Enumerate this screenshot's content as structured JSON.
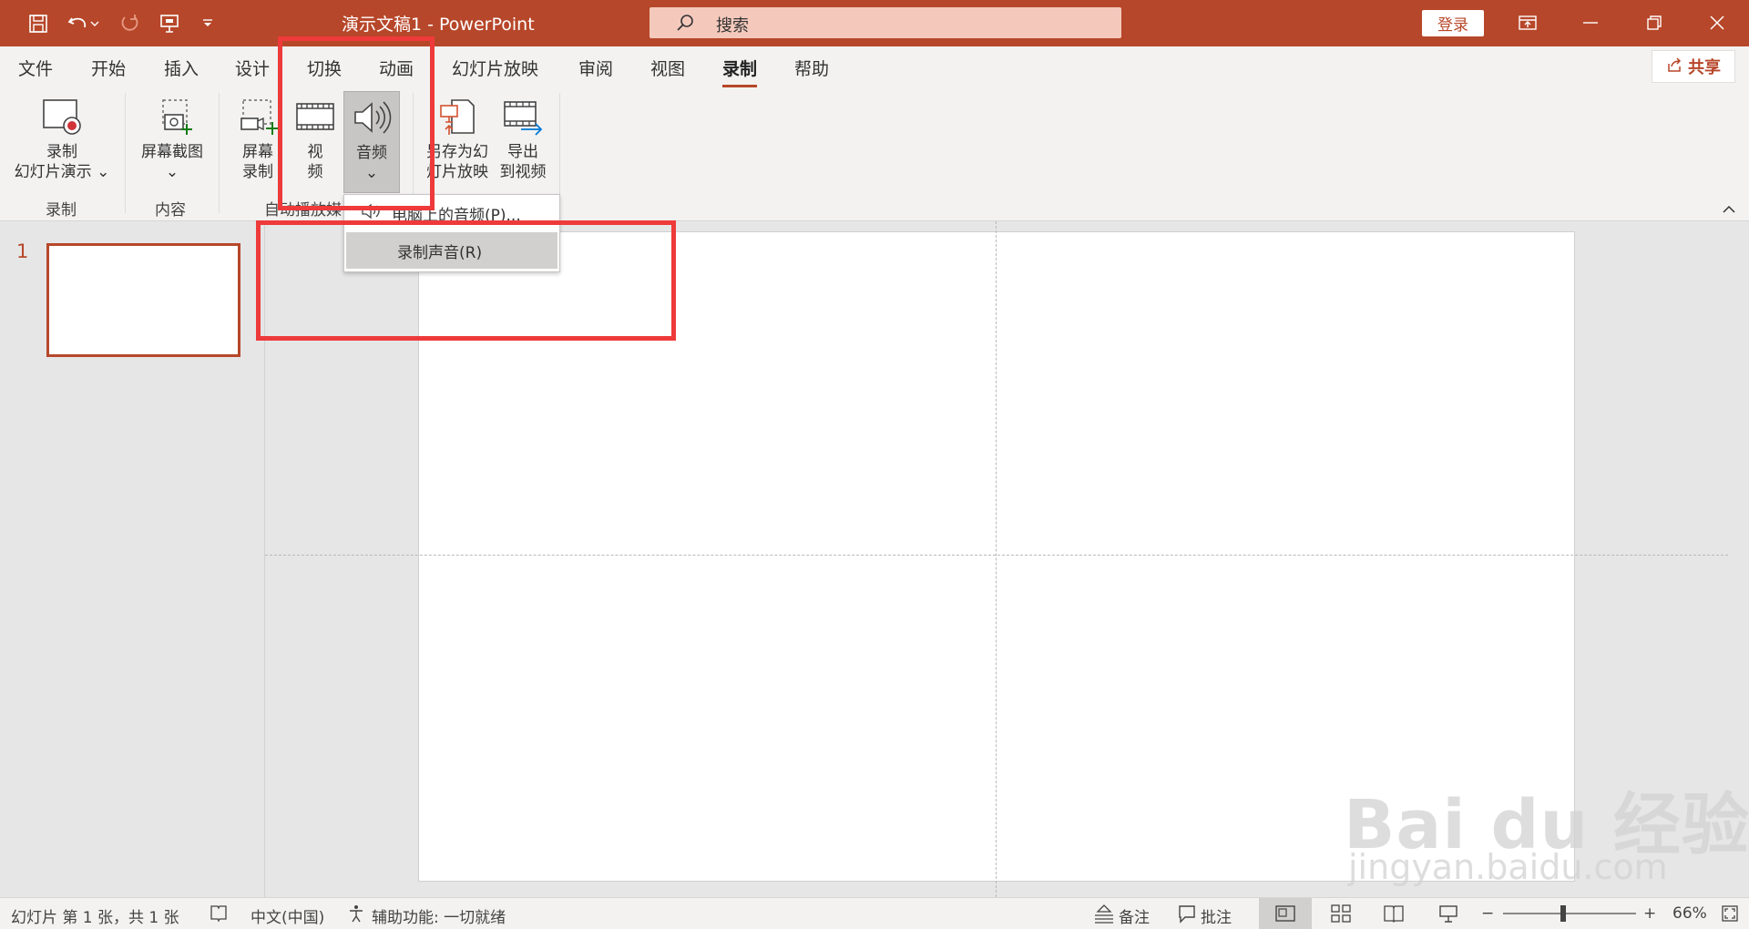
{
  "title_bar": {
    "doc_title": "演示文稿1  -  PowerPoint",
    "search_placeholder": "搜索",
    "login_label": "登录"
  },
  "menu": {
    "tabs": [
      "文件",
      "开始",
      "插入",
      "设计",
      "切换",
      "动画",
      "幻灯片放映",
      "审阅",
      "视图",
      "录制",
      "帮助"
    ],
    "active_tab": "录制",
    "share_label": "共享"
  },
  "ribbon": {
    "record_slideshow": {
      "line1": "录制",
      "line2": "幻灯片演示"
    },
    "screenshot": {
      "line1": "屏幕截图"
    },
    "screen_record": {
      "line1": "屏幕",
      "line2": "录制"
    },
    "video": {
      "line1": "视",
      "line2": "频"
    },
    "audio": {
      "line1": "音频"
    },
    "save_as_show": {
      "line1": "另存为幻",
      "line2": "灯片放映"
    },
    "export_video": {
      "line1": "导出",
      "line2": "到视频"
    },
    "groups": {
      "record": "录制",
      "content": "内容",
      "autoplay": "自动播放媒"
    }
  },
  "audio_dropdown": {
    "items": [
      "电脑上的音频(P)...",
      "录制声音(R)"
    ],
    "highlighted_index": 1
  },
  "slides_pane": {
    "slide_number": "1"
  },
  "status_bar": {
    "slide_info": "幻灯片 第 1 张，共 1 张",
    "language": "中文(中国)",
    "accessibility": "辅助功能: 一切就绪",
    "notes": "备注",
    "comments": "批注",
    "zoom_minus": "−",
    "zoom_plus": "+",
    "zoom_level": "66%",
    "zoom_fraction": 0.45
  },
  "watermark": {
    "main": "Bai du 经验",
    "url": "jingyan.baidu.com"
  },
  "colors": {
    "accent": "#b7472a",
    "highlight": "#ee3a3a"
  }
}
